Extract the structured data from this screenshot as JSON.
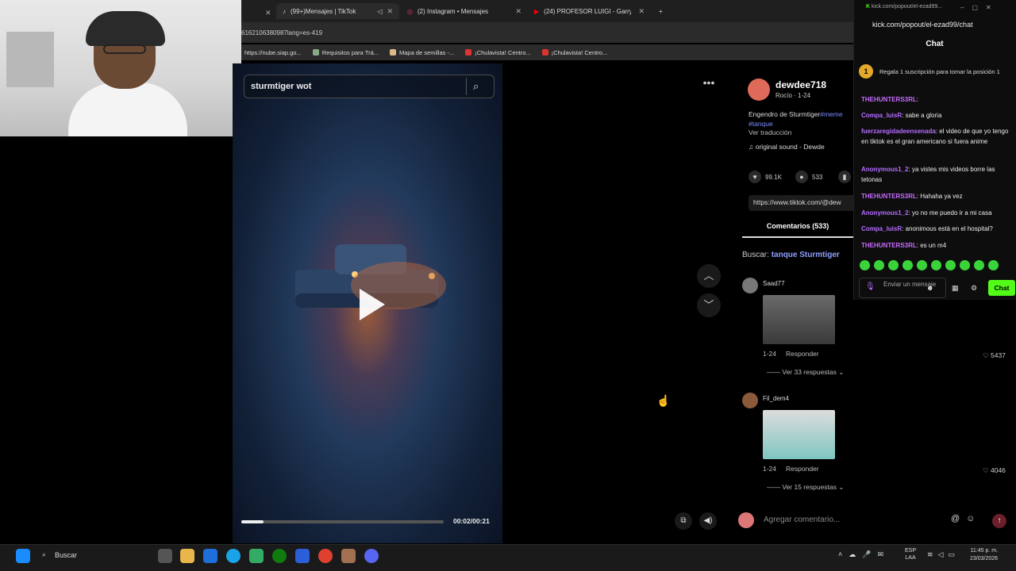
{
  "browser": {
    "tabs": [
      {
        "label": "(99+)Mensajes | TikTok",
        "active": true
      },
      {
        "label": "(2) Instagram • Mensajes",
        "active": false
      },
      {
        "label": "(24) PROFESOR LUIGI - Garry's",
        "active": false
      }
    ],
    "new_tab": "+",
    "address_partial": "6162106380987lang=es-419",
    "bookmarks": [
      "https://nube.siap.go...",
      "Requisitos para Trá...",
      "Mapa de semillas -...",
      "¡Chulavista! Centro...",
      "¡Chulavista! Centro..."
    ]
  },
  "video": {
    "search_query": "sturmtiger wot",
    "time": "00:02/00:21",
    "progress": 0.11
  },
  "post": {
    "username": "dewdee718",
    "subline": "Rocío · 1-24",
    "description": "Engendro de Sturmtiger",
    "hashtag1": "#meme",
    "hashtag2": "#tanque",
    "translate": "Ver traducción",
    "sound": "original sound - Dewde",
    "likes": "99.1K",
    "comments": "533",
    "link": "https://www.tiktok.com/@dew",
    "comments_tab": "Comentarios (533)",
    "search_label": "Buscar:",
    "search_term": "tanque Sturmtiger"
  },
  "comments": [
    {
      "name": "Saad77",
      "meta": "1-24",
      "reply": "Responder",
      "likes": "5437",
      "more": "Ver 33 respuestas"
    },
    {
      "name": "Fil_dem4",
      "meta": "1-24",
      "reply": "Responder",
      "likes": "4046",
      "more": "Ver 15 respuestas"
    }
  ],
  "comment_input_placeholder": "Agregar comentario...",
  "kick": {
    "window_title": "kick.com/popout/el-ezad99...",
    "url": "kick.com/popout/el-ezad99/chat",
    "header": "Chat",
    "gift_badge": "1",
    "gift_text": "Regala 1 suscripción para tomar la posición 1",
    "messages": [
      {
        "user": "THEHUNTERS3RL",
        "text": ""
      },
      {
        "user": "Compa_luisR",
        "text": "sabe a gloria"
      },
      {
        "user": "fuerzaregidadeensenada",
        "text": "el video de que yo tengo en tiktok es el gran americano si fuera anime"
      },
      {
        "user": "Anonymous1_2",
        "text": "ya vistes mis videos borre las tetonas"
      },
      {
        "user": "THEHUNTERS3RL",
        "text": "Hahaha ya vez"
      },
      {
        "user": "Anonymous1_2",
        "text": "yo no me puedo ir a mi casa"
      },
      {
        "user": "Compa_luisR",
        "text": "anonimous está en el hospital?"
      },
      {
        "user": "THEHUNTERS3RL",
        "text": "es un m4"
      }
    ],
    "input_placeholder": "Enviar un mensaje",
    "send_label": "Chat"
  },
  "taskbar": {
    "search": "Buscar",
    "lang": "ESP",
    "lang2": "LAA",
    "time": "11:45 p. m.",
    "date": "23/03/2026"
  },
  "colors": {
    "kick_green": "#53fc18",
    "tiktok_link": "#8fa0ff"
  }
}
